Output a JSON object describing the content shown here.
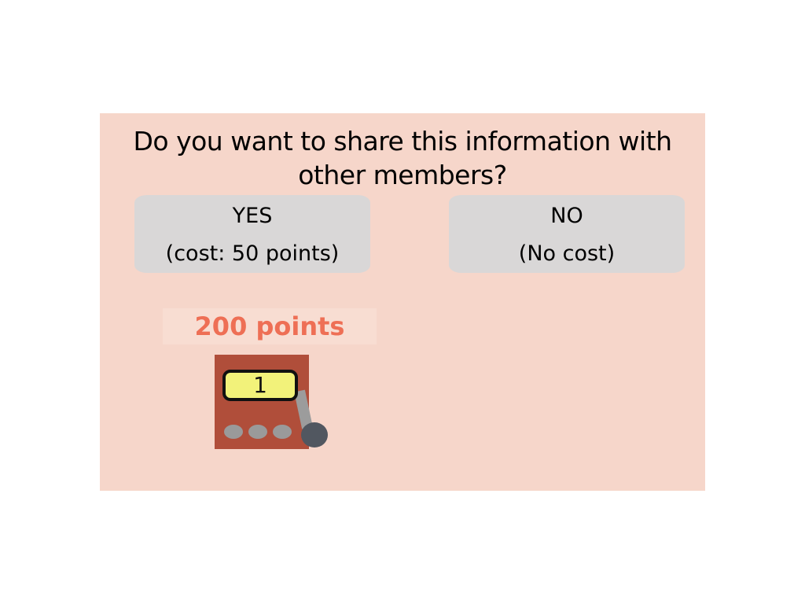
{
  "dialog": {
    "question": "Do you want to share this information with other members?",
    "yes_label": "YES",
    "yes_cost": "(cost: 50 points)",
    "no_label": "NO",
    "no_cost": "(No cost)"
  },
  "status": {
    "points": "200 points"
  },
  "slot_machine": {
    "display_value": "1",
    "icon": "slot-machine-icon"
  },
  "colors": {
    "panel_background": "#f6d6ca",
    "button_background": "#d9d7d7",
    "points_text": "#ee6f55",
    "machine_body": "#b04e3a",
    "machine_window": "#f2f27a"
  }
}
